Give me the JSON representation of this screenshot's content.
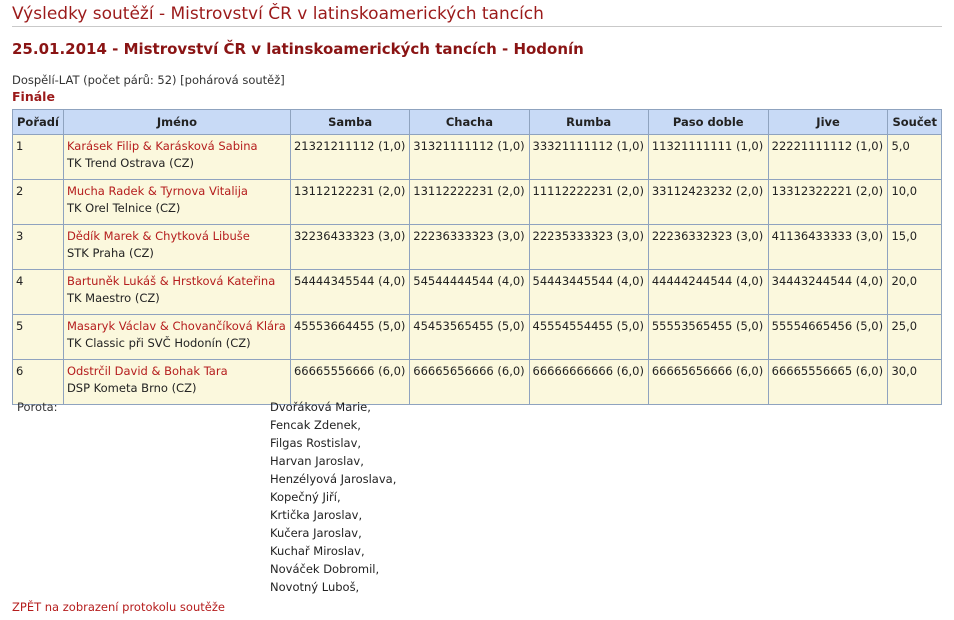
{
  "page": {
    "title": "Výsledky soutěží - Mistrovství ČR v latinskoamerických tancích",
    "heading": "25.01.2014 - Mistrovství ČR v latinskoamerických tancích - Hodonín",
    "info": "Dospělí-LAT (počet párů: 52) [pohárová soutěž]",
    "round": "Finále"
  },
  "table": {
    "headers": [
      "Pořadí",
      "Jméno",
      "Samba",
      "Chacha",
      "Rumba",
      "Paso doble",
      "Jive",
      "Součet"
    ],
    "rows": [
      {
        "place": "1",
        "couple": "Karásek Filip & Karásková Sabina",
        "club": "TK Trend Ostrava (CZ)",
        "samba": "21321211112 (1,0)",
        "chacha": "31321111112 (1,0)",
        "rumba": "33321111112 (1,0)",
        "paso": "11321111111 (1,0)",
        "jive": "22221111112 (1,0)",
        "sum": "5,0"
      },
      {
        "place": "2",
        "couple": "Mucha Radek & Tyrnova Vitalija",
        "club": "TK Orel Telnice (CZ)",
        "samba": "13112122231 (2,0)",
        "chacha": "13112222231 (2,0)",
        "rumba": "11112222231 (2,0)",
        "paso": "33112423232 (2,0)",
        "jive": "13312322221 (2,0)",
        "sum": "10,0"
      },
      {
        "place": "3",
        "couple": "Dědík Marek & Chytková Libuše",
        "club": "STK Praha (CZ)",
        "samba": "32236433323 (3,0)",
        "chacha": "22236333323 (3,0)",
        "rumba": "22235333323 (3,0)",
        "paso": "22236332323 (3,0)",
        "jive": "41136433333 (3,0)",
        "sum": "15,0"
      },
      {
        "place": "4",
        "couple": "Bartuněk Lukáš & Hrstková Kateřina",
        "club": "TK Maestro (CZ)",
        "samba": "54444345544 (4,0)",
        "chacha": "54544444544 (4,0)",
        "rumba": "54443445544 (4,0)",
        "paso": "44444244544 (4,0)",
        "jive": "34443244544 (4,0)",
        "sum": "20,0"
      },
      {
        "place": "5",
        "couple": "Masaryk Václav & Chovančíková Klára",
        "club": "TK Classic při SVČ Hodonín (CZ)",
        "samba": "45553664455 (5,0)",
        "chacha": "45453565455 (5,0)",
        "rumba": "45554554455 (5,0)",
        "paso": "55553565455 (5,0)",
        "jive": "55554665456 (5,0)",
        "sum": "25,0"
      },
      {
        "place": "6",
        "couple": "Odstrčil David & Bohak Tara",
        "club": "DSP Kometa Brno (CZ)",
        "samba": "66665556666 (6,0)",
        "chacha": "66665656666 (6,0)",
        "rumba": "66666666666 (6,0)",
        "paso": "66665656666 (6,0)",
        "jive": "66665556665 (6,0)",
        "sum": "30,0"
      }
    ]
  },
  "judges": {
    "label": "Porota:",
    "names": [
      "Dvořáková Marie,",
      "Fencak Zdenek,",
      "Filgas Rostislav,",
      "Harvan Jaroslav,",
      "Henzélyová Jaroslava,",
      "Kopečný Jiří,",
      "Krtička Jaroslav,",
      "Kučera Jaroslav,",
      "Kuchař Miroslav,",
      "Nováček Dobromil,",
      "Novotný Luboš,"
    ]
  },
  "back_link": "ZPĚT na zobrazení protokolu soutěže"
}
